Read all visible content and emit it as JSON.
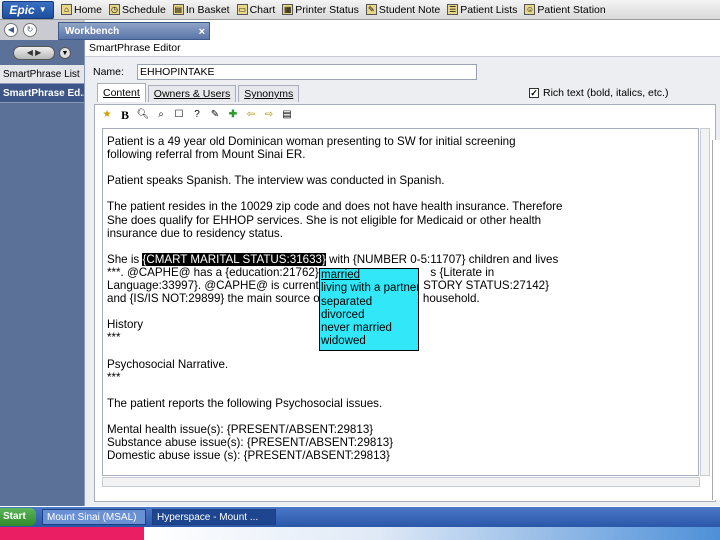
{
  "toolbar": {
    "epic_label": "Epic",
    "items": [
      {
        "label": "Home",
        "icon": "home-icon"
      },
      {
        "label": "Schedule",
        "icon": "schedule-icon"
      },
      {
        "label": "In Basket",
        "icon": "in-basket-icon"
      },
      {
        "label": "Chart",
        "icon": "chart-icon"
      },
      {
        "label": "Printer Status",
        "icon": "printer-icon"
      },
      {
        "label": "Student Note",
        "icon": "student-note-icon"
      },
      {
        "label": "Patient Lists",
        "icon": "patient-lists-icon"
      },
      {
        "label": "Patient Station",
        "icon": "patient-station-icon"
      }
    ]
  },
  "workbench": {
    "tab_label": "Workbench",
    "close": "×"
  },
  "sidebar": {
    "items": [
      {
        "label": "SmartPhrase List",
        "active": false
      },
      {
        "label": "SmartPhrase Ed...",
        "active": true
      }
    ]
  },
  "editor": {
    "title": "SmartPhrase Editor",
    "name_label": "Name:",
    "name_value": "EHHOPINTAKE",
    "tabs": [
      {
        "label": "Content",
        "active": true
      },
      {
        "label": "Owners & Users",
        "active": false
      },
      {
        "label": "Synonyms",
        "active": false
      }
    ],
    "rich_text_label": "Rich text (bold, italics, etc.)",
    "rich_text_checked": true
  },
  "content": {
    "l1": "Patient is a 49 year old Dominican woman presenting to SW for initial screening",
    "l2": "following referral from Mount Sinai ER.",
    "l3": "Patient speaks Spanish. The interview was conducted in Spanish.",
    "l4": "The patient resides in the 10029 zip code and does not have health insurance. Therefore",
    "l5": "She does qualify for EHHOP services. She is not eligible for Medicaid or other health",
    "l6": "insurance due to residency status.",
    "l7a": "She is ",
    "l7b": "{CMART MARITAL STATUS:31633}",
    "l7c": " with {NUMBER 0-5:11707} children and lives",
    "l8a": "***. @CAPHE@ has a {education:21762} e",
    "l8b": "s {Literate in",
    "l9a": "Language:33997}. @CAPHE@ is currently",
    "l9b": "STORY STATUS:27142}",
    "l10a": "and {IS/IS NOT:29899} the main source of",
    "l10b": "household.",
    "l11": "History",
    "l12": "***",
    "l13": "Psychosocial Narrative.",
    "l14": "***",
    "l15": "The patient reports the following Psychosocial issues.",
    "l16": "Mental health issue(s): {PRESENT/ABSENT:29813}",
    "l17": "Substance abuse issue(s): {PRESENT/ABSENT:29813}",
    "l18": "Domestic abuse issue (s): {PRESENT/ABSENT:29813}"
  },
  "dropdown": {
    "options": [
      "married",
      "living with a partner",
      "separated",
      "divorced",
      "never married",
      "widowed"
    ]
  },
  "taskbar": {
    "start": "Start",
    "tasks": [
      {
        "label": "Mount Sinai (MSAL)",
        "active": false
      },
      {
        "label": "Hyperspace - Mount ...",
        "active": true
      }
    ]
  }
}
